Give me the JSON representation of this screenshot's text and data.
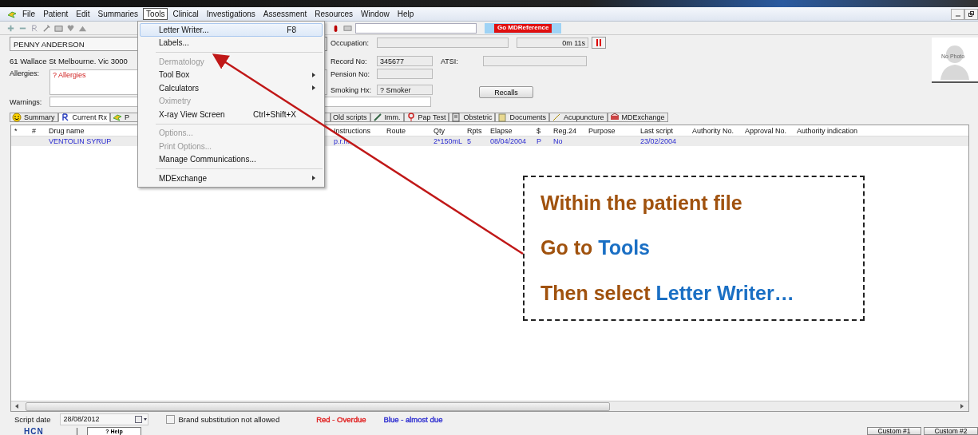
{
  "menu_bar": {
    "items": [
      {
        "label": "File",
        "selected": false
      },
      {
        "label": "Patient",
        "selected": false
      },
      {
        "label": "Edit",
        "selected": false
      },
      {
        "label": "Summaries",
        "selected": false
      },
      {
        "label": "Tools",
        "selected": true
      },
      {
        "label": "Clinical",
        "selected": false
      },
      {
        "label": "Investigations",
        "selected": false
      },
      {
        "label": "Assessment",
        "selected": false
      },
      {
        "label": "Resources",
        "selected": false
      },
      {
        "label": "Window",
        "selected": false
      },
      {
        "label": "Help",
        "selected": false
      }
    ]
  },
  "toolbar": {
    "go_button": "Go MDReference"
  },
  "patient": {
    "name": "PENNY ANDERSON",
    "address": "61 Wallace St Melbourne. Vic  3000",
    "allergies_label": "Allergies:",
    "allergies": "? Allergies",
    "warnings_label": "Warnings:",
    "fields": [
      {
        "label": "Occupation:"
      },
      {
        "label": "Record No:",
        "value": "345677"
      },
      {
        "label": "Pension No:"
      },
      {
        "label": "Smoking Hx:",
        "value": "? Smoker"
      }
    ],
    "timer": "0m 11s",
    "atsi_label": "ATSI:",
    "recalls_button": "Recalls",
    "photo_text": "No Photo"
  },
  "tabs": [
    {
      "label": "Summary",
      "selected": false
    },
    {
      "label": "Current Rx",
      "selected": true
    },
    {
      "label": "P",
      "selected": false
    },
    {
      "label": "Old scripts",
      "selected": false
    },
    {
      "label": "Imm.",
      "selected": false
    },
    {
      "label": "Pap Test",
      "selected": false
    },
    {
      "label": "Obstetric",
      "selected": false
    },
    {
      "label": "Documents",
      "selected": false
    },
    {
      "label": "Acupuncture",
      "selected": false
    },
    {
      "label": "MDExchange",
      "selected": false
    }
  ],
  "table": {
    "columns": [
      "*",
      "#",
      "Drug name",
      "Instructions",
      "Route",
      "Qty",
      "Rpts",
      "Elapse",
      "$",
      "Reg.24",
      "Purpose",
      "Last script",
      "Authority No.",
      "Approval No.",
      "Authority indication"
    ],
    "rows": [
      [
        "",
        "",
        "VENTOLIN SYRUP",
        "p.r.n.",
        "",
        "2*150mL",
        "5",
        "08/04/2004",
        "P",
        "No",
        "",
        "23/02/2004",
        "",
        "",
        ""
      ]
    ]
  },
  "footer": {
    "script_date_label": "Script date",
    "script_date": "28/08/2012",
    "brand_substitution": {
      "label": "Brand substitution not allowed",
      "checked": false
    },
    "legend": [
      {
        "label": "Red - Overdue",
        "color": "#e02020"
      },
      {
        "label": "Blue - almost due",
        "color": "#3030d0"
      }
    ]
  },
  "bottom_bar": {
    "logo": "HCN",
    "help_button": "? Help",
    "custom_buttons": [
      "Custom #1",
      "Custom #2"
    ]
  },
  "tools_menu": [
    {
      "kind": "item",
      "label": "Letter Writer...",
      "shortcut": "F8",
      "selected": true,
      "disabled": false,
      "submenu": false
    },
    {
      "kind": "item",
      "label": "Labels...",
      "selected": false,
      "disabled": false,
      "submenu": false
    },
    {
      "kind": "separator"
    },
    {
      "kind": "item",
      "label": "Dermatology",
      "selected": false,
      "disabled": true,
      "submenu": false
    },
    {
      "kind": "item",
      "label": "Tool Box",
      "selected": false,
      "disabled": false,
      "submenu": true
    },
    {
      "kind": "item",
      "label": "Calculators",
      "selected": false,
      "disabled": false,
      "submenu": true
    },
    {
      "kind": "item",
      "label": "Oximetry",
      "selected": false,
      "disabled": true,
      "submenu": false
    },
    {
      "kind": "item",
      "label": "X-ray View Screen",
      "shortcut": "Ctrl+Shift+X",
      "selected": false,
      "disabled": false,
      "submenu": false
    },
    {
      "kind": "separator"
    },
    {
      "kind": "item",
      "label": "Options...",
      "selected": false,
      "disabled": true,
      "submenu": false
    },
    {
      "kind": "item",
      "label": "Print Options...",
      "selected": false,
      "disabled": true,
      "submenu": false
    },
    {
      "kind": "item",
      "label": "Manage Communications...",
      "selected": false,
      "disabled": false,
      "submenu": false
    },
    {
      "kind": "separator"
    },
    {
      "kind": "item",
      "label": "MDExchange",
      "selected": false,
      "disabled": false,
      "submenu": true
    }
  ],
  "callout": {
    "lines": [
      [
        {
          "text": "Within the patient file",
          "emphasis": false
        }
      ],
      [
        {
          "text": "Go to ",
          "emphasis": false
        },
        {
          "text": "Tools",
          "emphasis": true
        }
      ],
      [
        {
          "text": "Then select ",
          "emphasis": false
        },
        {
          "text": "Letter Writer…",
          "emphasis": true
        }
      ]
    ]
  }
}
